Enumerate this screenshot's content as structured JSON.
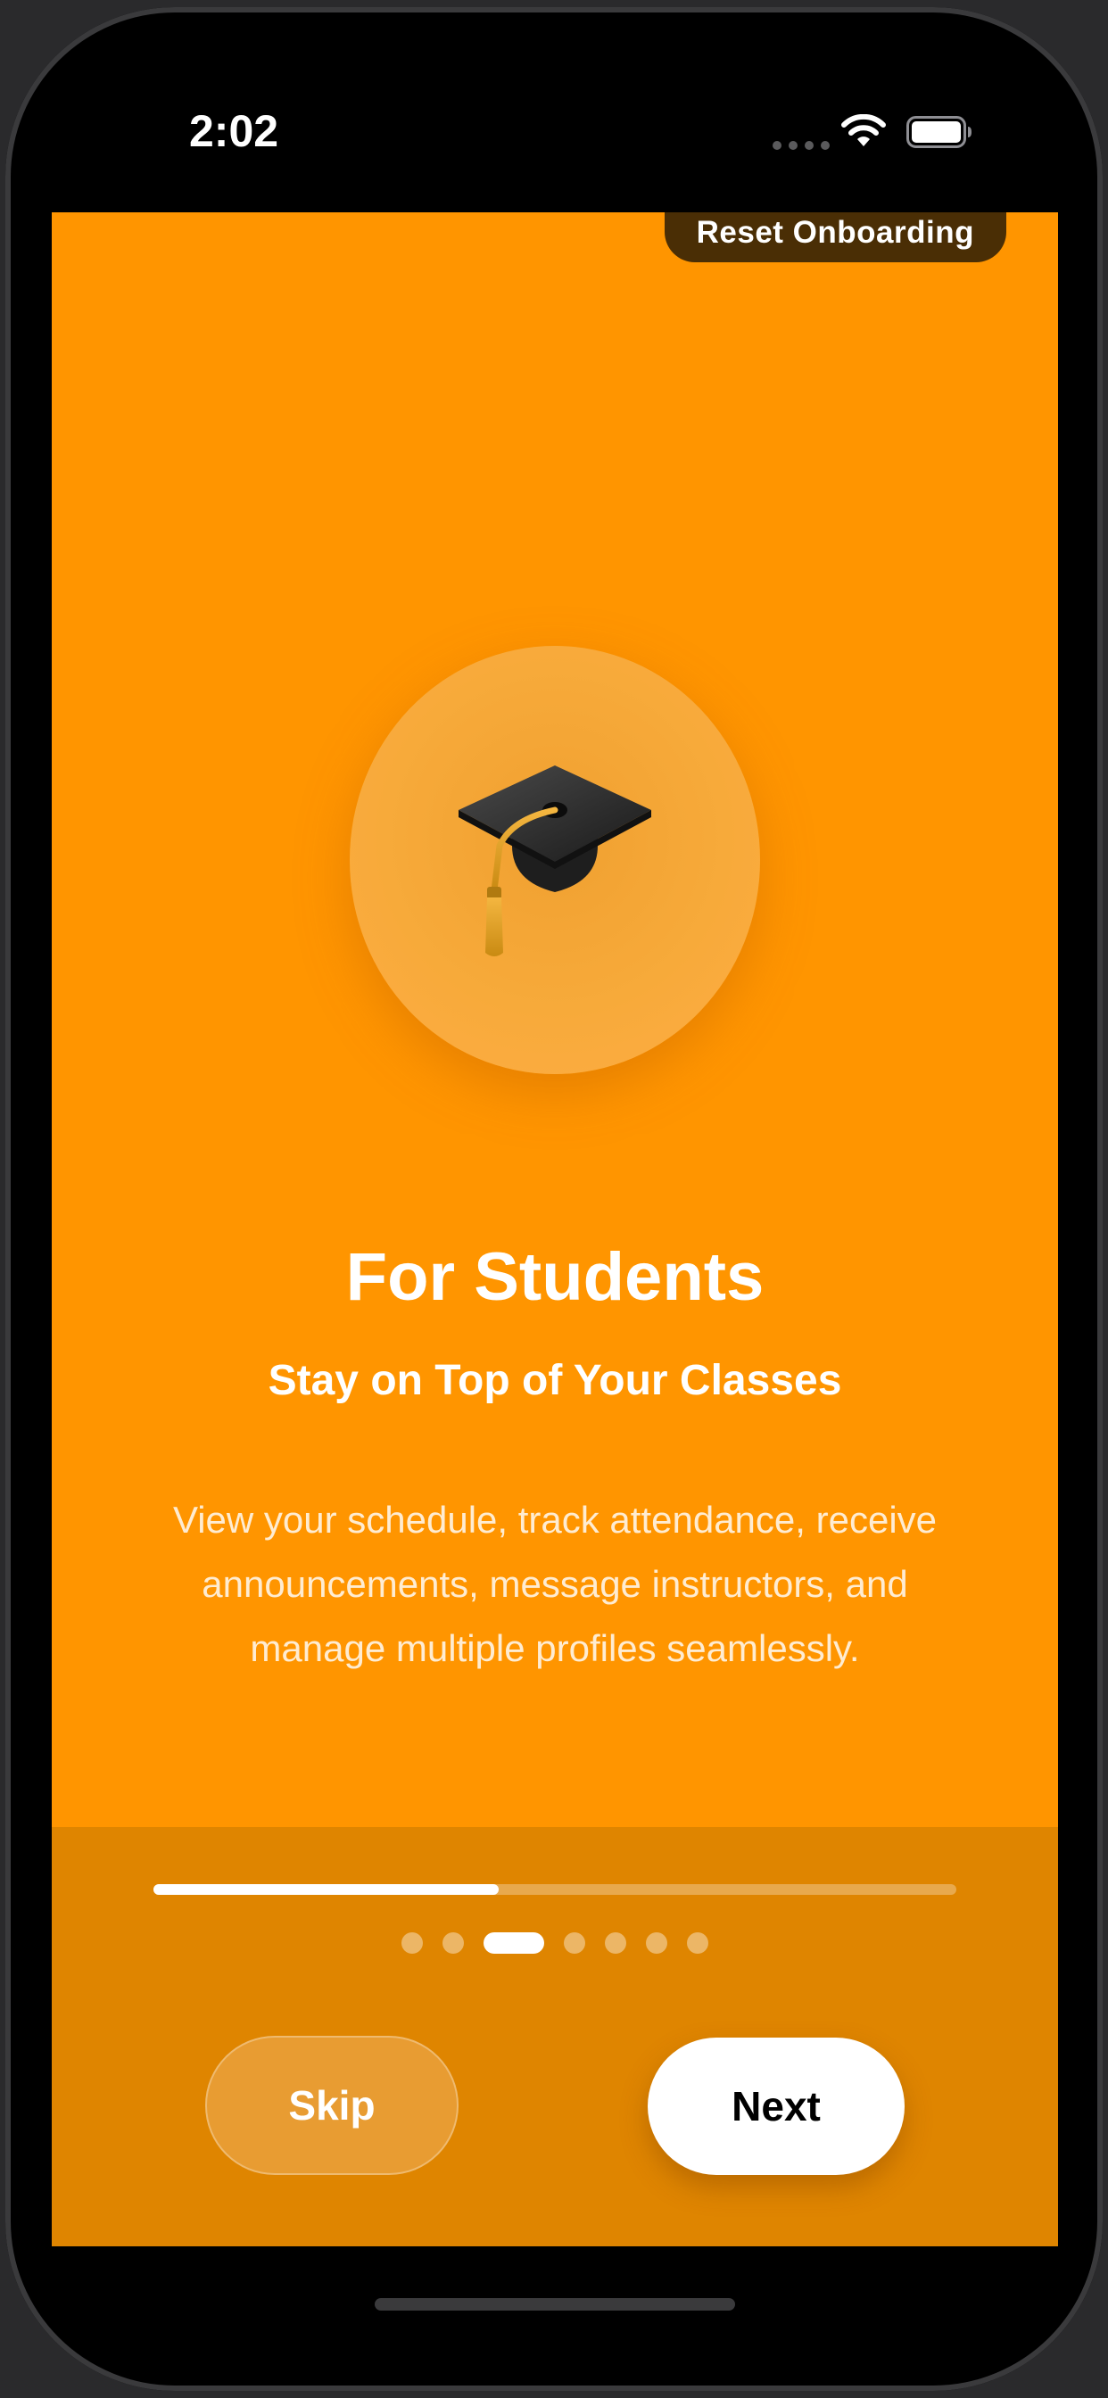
{
  "status_bar": {
    "time": "2:02",
    "icons": [
      "cellular-signal-icon",
      "wifi-icon",
      "battery-icon"
    ]
  },
  "header": {
    "reset_label": "Reset Onboarding"
  },
  "onboarding": {
    "icon": "graduation-cap-icon",
    "title": "For Students",
    "subtitle": "Stay on Top of Your Classes",
    "description": "View your schedule, track attendance, receive announcements, message instructors, and manage multiple profiles seamlessly.",
    "progress": 0.43,
    "total_pages": 7,
    "current_page": 3
  },
  "buttons": {
    "skip_label": "Skip",
    "next_label": "Next"
  },
  "colors": {
    "accent": "#ff9500",
    "panel": "#df8500",
    "reset_background": "#4a2e05"
  }
}
